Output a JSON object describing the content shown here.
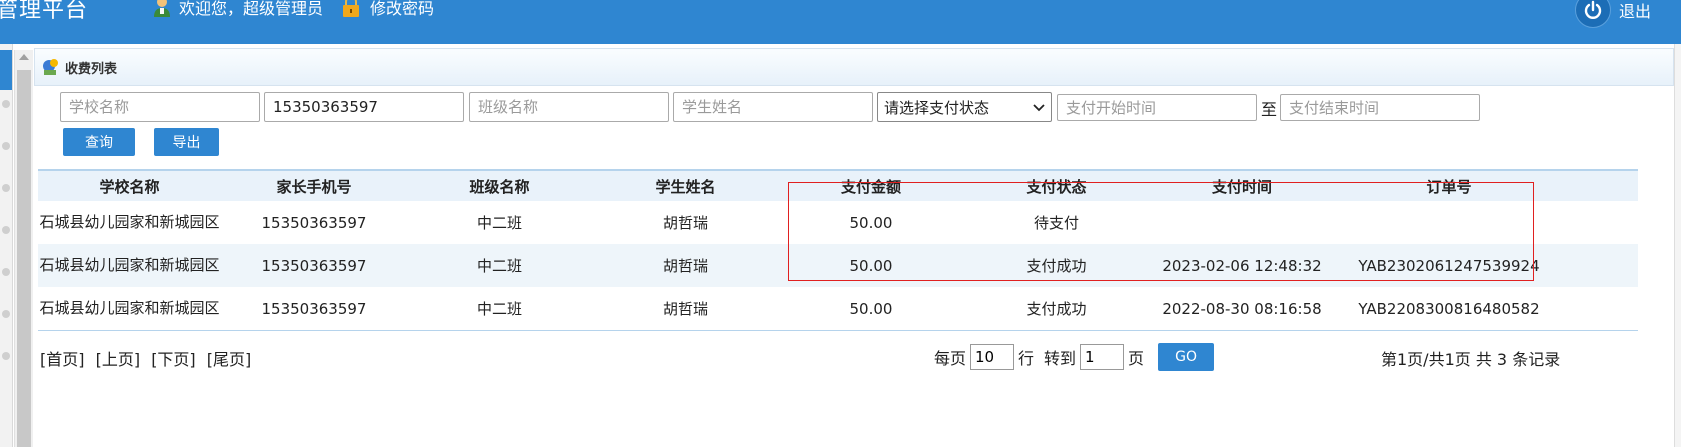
{
  "header": {
    "app_title": "管理平台",
    "welcome": "欢迎您，超级管理员",
    "change_password": "修改密码",
    "logout": "退出"
  },
  "panel": {
    "title": "收费列表"
  },
  "filters": {
    "school_placeholder": "学校名称",
    "phone_value": "15350363597",
    "class_placeholder": "班级名称",
    "student_placeholder": "学生姓名",
    "status_select": "请选择支付状态",
    "start_placeholder": "支付开始时间",
    "to_label": "至",
    "end_placeholder": "支付结束时间",
    "query_button": "查询",
    "export_button": "导出"
  },
  "table": {
    "columns": [
      "学校名称",
      "家长手机号",
      "班级名称",
      "学生姓名",
      "支付金额",
      "支付状态",
      "支付时间",
      "订单号"
    ],
    "rows": [
      [
        "石城县幼儿园家和新城园区",
        "15350363597",
        "中二班",
        "胡哲瑞",
        "50.00",
        "待支付",
        "",
        ""
      ],
      [
        "石城县幼儿园家和新城园区",
        "15350363597",
        "中二班",
        "胡哲瑞",
        "50.00",
        "支付成功",
        "2023-02-06 12:48:32",
        "YAB2302061247539924"
      ],
      [
        "石城县幼儿园家和新城园区",
        "15350363597",
        "中二班",
        "胡哲瑞",
        "50.00",
        "支付成功",
        "2022-08-30 08:16:58",
        "YAB2208300816480582"
      ]
    ]
  },
  "pagination": {
    "first": "[首页]",
    "prev": "[上页]",
    "next": "[下页]",
    "last": "[尾页]",
    "per_page_label": "每页",
    "per_page_value": "10",
    "rows_unit": "行",
    "goto_label": "转到",
    "goto_value": "1",
    "page_unit": "页",
    "go_button": "GO",
    "summary": "第1页/共1页 共 3 条记录"
  },
  "colors": {
    "header_bg": "#2f86d1",
    "highlight_border": "#e02020"
  },
  "icons": [
    "user-icon",
    "lock-icon",
    "power-icon",
    "list-icon",
    "chevron-down-icon"
  ]
}
